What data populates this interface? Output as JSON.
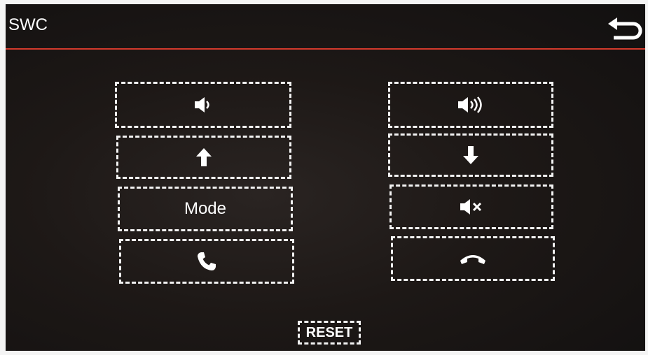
{
  "header": {
    "title": "SWC",
    "back_icon": "back-arrow-icon"
  },
  "colors": {
    "accent_line": "#d43a2c",
    "background": "#1d1816",
    "foreground": "#ffffff"
  },
  "left_column": [
    {
      "icon": "volume-down-icon"
    },
    {
      "icon": "arrow-up-icon"
    },
    {
      "label": "Mode"
    },
    {
      "icon": "phone-answer-icon"
    }
  ],
  "right_column": [
    {
      "icon": "volume-up-icon"
    },
    {
      "icon": "arrow-down-icon"
    },
    {
      "icon": "mute-icon"
    },
    {
      "icon": "phone-hangup-icon"
    }
  ],
  "footer": {
    "reset_label": "RESET"
  }
}
